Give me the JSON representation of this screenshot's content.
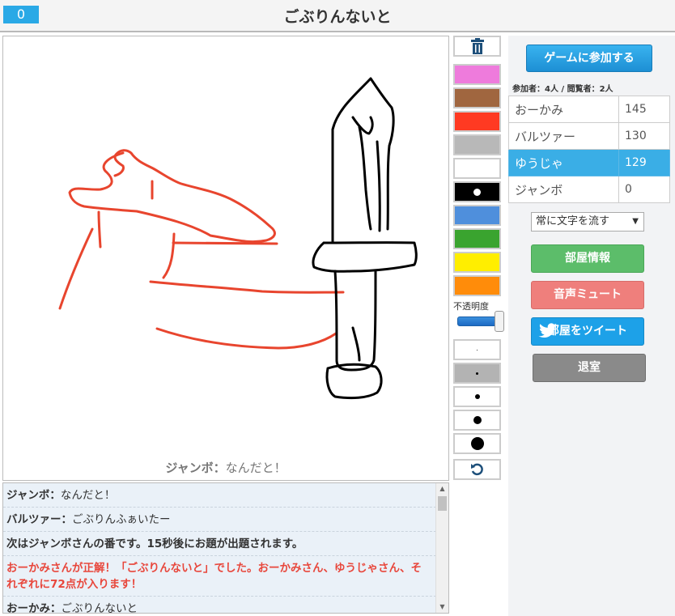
{
  "header": {
    "timer": "0",
    "title": "ごぶりんないと"
  },
  "canvas": {
    "last_message_name": "ジャンボ：",
    "last_message_text": "なんだと！"
  },
  "chat": [
    {
      "name": "ジャンボ：",
      "text": "なんだと！",
      "type": "user"
    },
    {
      "name": "バルツァー：",
      "text": "ごぶりんふぁいたー",
      "type": "user"
    },
    {
      "name": "",
      "text": "次はジャンボさんの番です。15秒後にお題が出題されます。",
      "type": "sys"
    },
    {
      "name": "",
      "text": "おーかみさんが正解！「ごぶりんないと」でした。おーかみさん、ゆうじゃさん、それぞれに72点が入ります！",
      "type": "correct"
    },
    {
      "name": "おーかみ：",
      "text": "ごぶりんないと",
      "type": "user"
    }
  ],
  "tools": {
    "trash_icon": "trash-icon",
    "colors": [
      "#ee7bdc",
      "#a0663f",
      "#ff3a22",
      "#b8b8b8",
      "#ffffff",
      "#000000",
      "#4f8fdc",
      "#3aa42f",
      "#ffee00",
      "#ff8c0a"
    ],
    "selected_color": 5,
    "opacity_label": "不透明度",
    "opacity_value": 1.0,
    "brush_sizes": [
      1,
      3,
      6,
      10,
      16
    ],
    "selected_size": 1,
    "undo_icon": "undo-icon"
  },
  "side": {
    "join_label": "ゲームに参加する",
    "counts_text": "参加者：4人 / 閲覧者：2人",
    "players": [
      {
        "name": "おーかみ",
        "score": "145",
        "active": false
      },
      {
        "name": "バルツァー",
        "score": "130",
        "active": false
      },
      {
        "name": "ゆうじゃ",
        "score": "129",
        "active": true
      },
      {
        "name": "ジャンボ",
        "score": "0",
        "active": false
      }
    ],
    "chat_mode": "常に文字を流す",
    "room_info_label": "部屋情報",
    "mute_label": "音声ミュート",
    "tweet_label": "部屋をツイート",
    "leave_label": "退室"
  }
}
